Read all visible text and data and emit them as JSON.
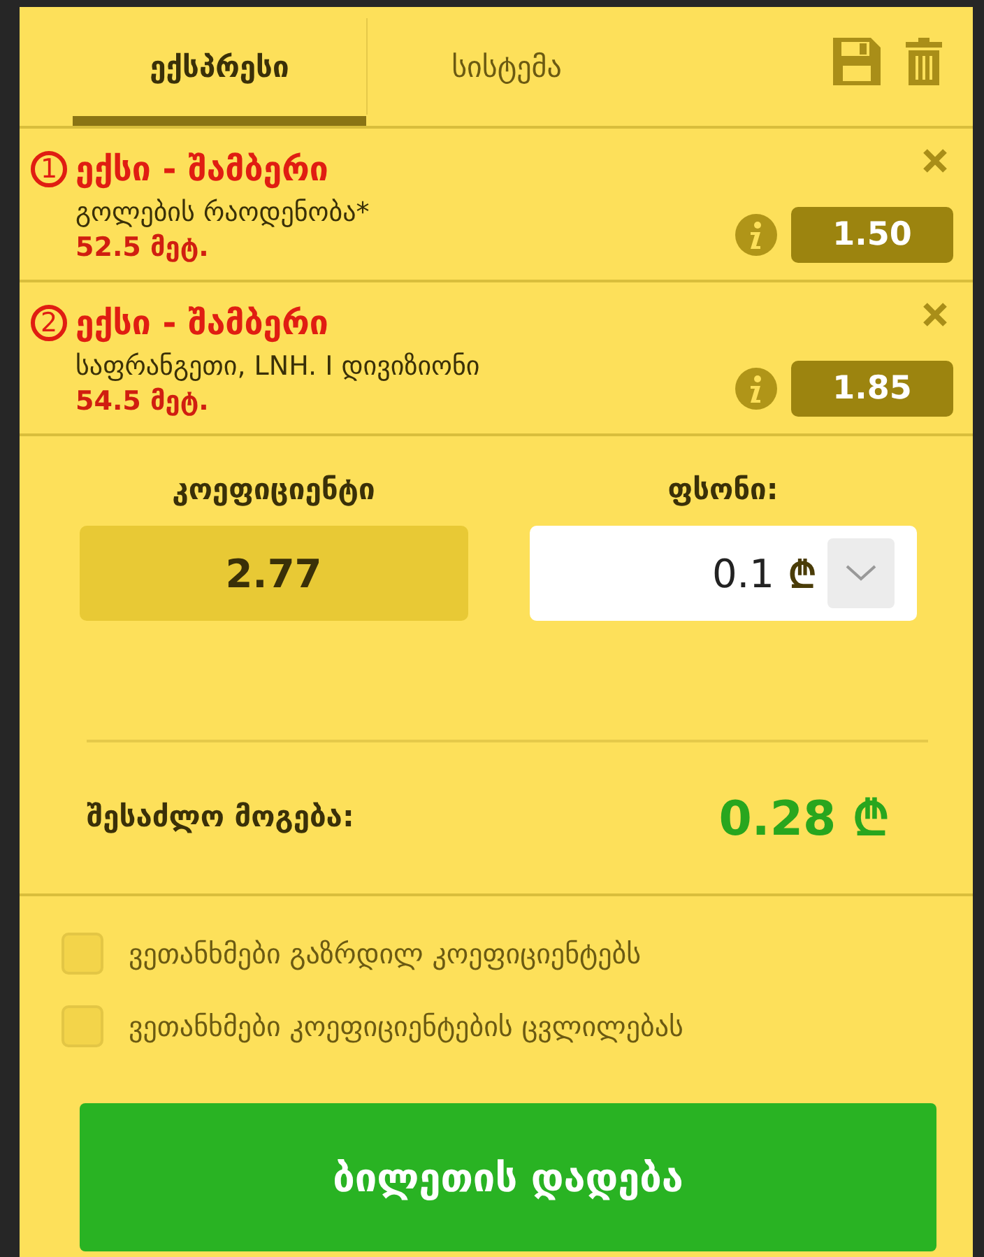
{
  "tabs": [
    {
      "label": "ექსპრესი",
      "selected": true
    },
    {
      "label": "სისტემა",
      "selected": false
    }
  ],
  "bets": [
    {
      "number": "1",
      "title": "ექსი - შამბერი",
      "market": "გოლების რაოდენობა*",
      "pick": "52.5 მეტ.",
      "odds": "1.50"
    },
    {
      "number": "2",
      "title": "ექსი - შამბერი",
      "market": "საფრანგეთი, LNH. I დივიზიონი",
      "pick": "54.5 მეტ.",
      "odds": "1.85"
    }
  ],
  "total_odds": {
    "label": "კოეფიციენტი",
    "value": "2.77"
  },
  "stake": {
    "label": "ფსონი:",
    "value": "0.1",
    "currency": "₾"
  },
  "winnings": {
    "label": "შესაძლო მოგება:",
    "value": "0.28 ₾"
  },
  "options": [
    {
      "label": "ვეთანხმები გაზრდილ კოეფიციენტებს",
      "checked": false
    },
    {
      "label": "ვეთანხმები კოეფიციენტების ცვლილებას",
      "checked": false
    }
  ],
  "submit": "ბილეთის დადება"
}
